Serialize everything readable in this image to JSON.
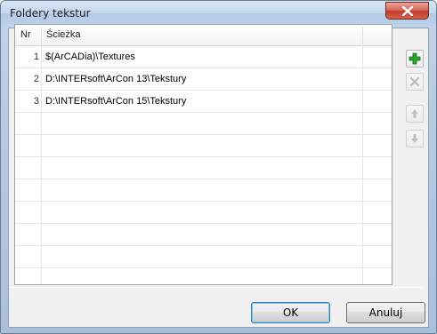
{
  "window": {
    "title": "Foldery tekstur"
  },
  "list": {
    "columns": [
      "Nr",
      "Ścieżka"
    ],
    "rows": [
      {
        "nr": "1",
        "path": "$(ArCADia)\\Textures"
      },
      {
        "nr": "2",
        "path": "D:\\INTERsoft\\ArCon 13\\Tekstury"
      },
      {
        "nr": "3",
        "path": "D:\\INTERsoft\\ArCon 15\\Tekstury"
      }
    ]
  },
  "side_buttons": [
    {
      "icon": "plus-icon",
      "enabled": true,
      "color": "#2aa52a"
    },
    {
      "icon": "delete-icon",
      "enabled": false
    },
    {
      "icon": "arrow-up-icon",
      "enabled": false
    },
    {
      "icon": "arrow-down-icon",
      "enabled": false
    }
  ],
  "buttons": {
    "ok": "OK",
    "cancel": "Anuluj"
  }
}
